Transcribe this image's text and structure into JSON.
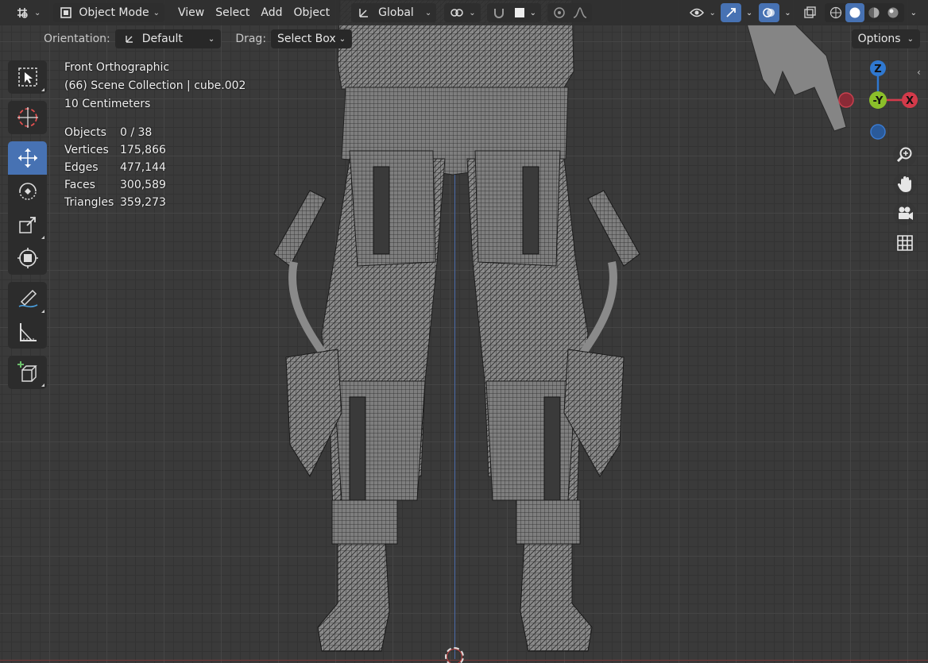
{
  "header": {
    "mode_label": "Object Mode",
    "menus": [
      "View",
      "Select",
      "Add",
      "Object"
    ],
    "transform_orientation": "Global"
  },
  "tool_settings": {
    "orientation_label": "Orientation:",
    "orientation_value": "Default",
    "drag_label": "Drag:",
    "drag_value": "Select Box",
    "options_label": "Options"
  },
  "overlay": {
    "view_name": "Front Orthographic",
    "collection": "(66) Scene Collection | cube.002",
    "grid_scale": "10 Centimeters"
  },
  "stats": [
    {
      "label": "Objects",
      "value": "0 / 38"
    },
    {
      "label": "Vertices",
      "value": "175,866"
    },
    {
      "label": "Edges",
      "value": "477,144"
    },
    {
      "label": "Faces",
      "value": "300,589"
    },
    {
      "label": "Triangles",
      "value": "359,273"
    }
  ],
  "gizmo": {
    "z_label": "Z",
    "y_label": "-Y",
    "x_label": "X"
  },
  "colors": {
    "accent": "#4772b3",
    "x_axis": "#d33a4a",
    "y_axis": "#8bbf2a",
    "z_axis": "#2f78d0"
  },
  "left_tools": [
    "select-box",
    "cursor",
    "move",
    "rotate",
    "scale",
    "transform",
    "annotate",
    "measure",
    "add-cube"
  ],
  "active_tool": "move"
}
